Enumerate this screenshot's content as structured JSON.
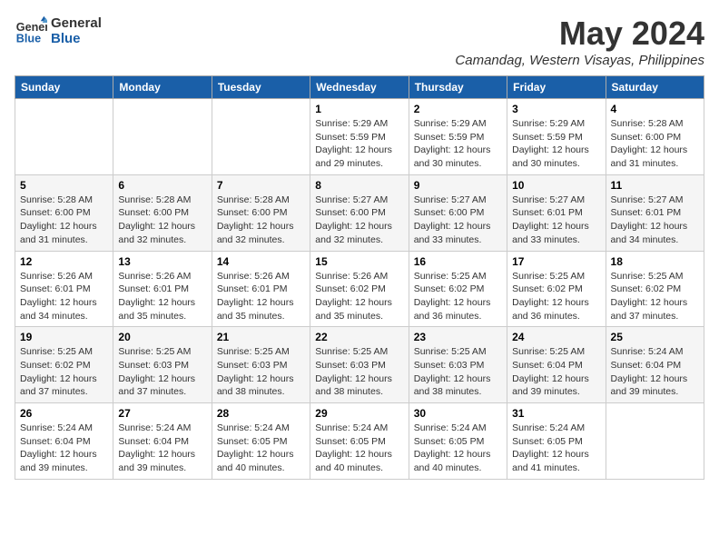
{
  "header": {
    "logo_line1": "General",
    "logo_line2": "Blue",
    "month": "May 2024",
    "location": "Camandag, Western Visayas, Philippines"
  },
  "days_of_week": [
    "Sunday",
    "Monday",
    "Tuesday",
    "Wednesday",
    "Thursday",
    "Friday",
    "Saturday"
  ],
  "weeks": [
    [
      {
        "day": "",
        "info": ""
      },
      {
        "day": "",
        "info": ""
      },
      {
        "day": "",
        "info": ""
      },
      {
        "day": "1",
        "info": "Sunrise: 5:29 AM\nSunset: 5:59 PM\nDaylight: 12 hours\nand 29 minutes."
      },
      {
        "day": "2",
        "info": "Sunrise: 5:29 AM\nSunset: 5:59 PM\nDaylight: 12 hours\nand 30 minutes."
      },
      {
        "day": "3",
        "info": "Sunrise: 5:29 AM\nSunset: 5:59 PM\nDaylight: 12 hours\nand 30 minutes."
      },
      {
        "day": "4",
        "info": "Sunrise: 5:28 AM\nSunset: 6:00 PM\nDaylight: 12 hours\nand 31 minutes."
      }
    ],
    [
      {
        "day": "5",
        "info": "Sunrise: 5:28 AM\nSunset: 6:00 PM\nDaylight: 12 hours\nand 31 minutes."
      },
      {
        "day": "6",
        "info": "Sunrise: 5:28 AM\nSunset: 6:00 PM\nDaylight: 12 hours\nand 32 minutes."
      },
      {
        "day": "7",
        "info": "Sunrise: 5:28 AM\nSunset: 6:00 PM\nDaylight: 12 hours\nand 32 minutes."
      },
      {
        "day": "8",
        "info": "Sunrise: 5:27 AM\nSunset: 6:00 PM\nDaylight: 12 hours\nand 32 minutes."
      },
      {
        "day": "9",
        "info": "Sunrise: 5:27 AM\nSunset: 6:00 PM\nDaylight: 12 hours\nand 33 minutes."
      },
      {
        "day": "10",
        "info": "Sunrise: 5:27 AM\nSunset: 6:01 PM\nDaylight: 12 hours\nand 33 minutes."
      },
      {
        "day": "11",
        "info": "Sunrise: 5:27 AM\nSunset: 6:01 PM\nDaylight: 12 hours\nand 34 minutes."
      }
    ],
    [
      {
        "day": "12",
        "info": "Sunrise: 5:26 AM\nSunset: 6:01 PM\nDaylight: 12 hours\nand 34 minutes."
      },
      {
        "day": "13",
        "info": "Sunrise: 5:26 AM\nSunset: 6:01 PM\nDaylight: 12 hours\nand 35 minutes."
      },
      {
        "day": "14",
        "info": "Sunrise: 5:26 AM\nSunset: 6:01 PM\nDaylight: 12 hours\nand 35 minutes."
      },
      {
        "day": "15",
        "info": "Sunrise: 5:26 AM\nSunset: 6:02 PM\nDaylight: 12 hours\nand 35 minutes."
      },
      {
        "day": "16",
        "info": "Sunrise: 5:25 AM\nSunset: 6:02 PM\nDaylight: 12 hours\nand 36 minutes."
      },
      {
        "day": "17",
        "info": "Sunrise: 5:25 AM\nSunset: 6:02 PM\nDaylight: 12 hours\nand 36 minutes."
      },
      {
        "day": "18",
        "info": "Sunrise: 5:25 AM\nSunset: 6:02 PM\nDaylight: 12 hours\nand 37 minutes."
      }
    ],
    [
      {
        "day": "19",
        "info": "Sunrise: 5:25 AM\nSunset: 6:02 PM\nDaylight: 12 hours\nand 37 minutes."
      },
      {
        "day": "20",
        "info": "Sunrise: 5:25 AM\nSunset: 6:03 PM\nDaylight: 12 hours\nand 37 minutes."
      },
      {
        "day": "21",
        "info": "Sunrise: 5:25 AM\nSunset: 6:03 PM\nDaylight: 12 hours\nand 38 minutes."
      },
      {
        "day": "22",
        "info": "Sunrise: 5:25 AM\nSunset: 6:03 PM\nDaylight: 12 hours\nand 38 minutes."
      },
      {
        "day": "23",
        "info": "Sunrise: 5:25 AM\nSunset: 6:03 PM\nDaylight: 12 hours\nand 38 minutes."
      },
      {
        "day": "24",
        "info": "Sunrise: 5:25 AM\nSunset: 6:04 PM\nDaylight: 12 hours\nand 39 minutes."
      },
      {
        "day": "25",
        "info": "Sunrise: 5:24 AM\nSunset: 6:04 PM\nDaylight: 12 hours\nand 39 minutes."
      }
    ],
    [
      {
        "day": "26",
        "info": "Sunrise: 5:24 AM\nSunset: 6:04 PM\nDaylight: 12 hours\nand 39 minutes."
      },
      {
        "day": "27",
        "info": "Sunrise: 5:24 AM\nSunset: 6:04 PM\nDaylight: 12 hours\nand 39 minutes."
      },
      {
        "day": "28",
        "info": "Sunrise: 5:24 AM\nSunset: 6:05 PM\nDaylight: 12 hours\nand 40 minutes."
      },
      {
        "day": "29",
        "info": "Sunrise: 5:24 AM\nSunset: 6:05 PM\nDaylight: 12 hours\nand 40 minutes."
      },
      {
        "day": "30",
        "info": "Sunrise: 5:24 AM\nSunset: 6:05 PM\nDaylight: 12 hours\nand 40 minutes."
      },
      {
        "day": "31",
        "info": "Sunrise: 5:24 AM\nSunset: 6:05 PM\nDaylight: 12 hours\nand 41 minutes."
      },
      {
        "day": "",
        "info": ""
      }
    ]
  ]
}
